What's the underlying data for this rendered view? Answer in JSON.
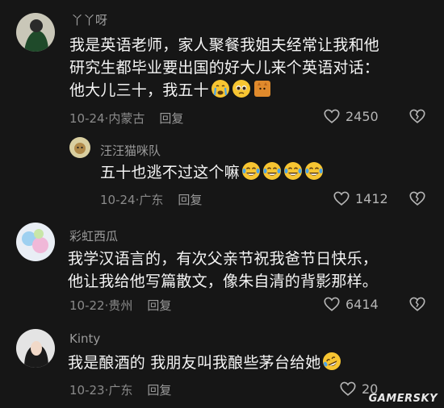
{
  "comments": [
    {
      "user": "丫丫呀",
      "lines": [
        "我是英语老师，家人聚餐我姐夫经常让我和他",
        "研究生都毕业要出国的好大儿来个英语对话：",
        "他大儿三十，我五十"
      ],
      "emojis": [
        "crying-face-emoji",
        "pleading-face-emoji",
        "cat-sticker-emoji"
      ],
      "date": "10-24",
      "location": "内蒙古",
      "reply_label": "回复",
      "likes": "2450"
    },
    {
      "user": "汪汪猫咪队",
      "lines": [
        "五十也逃不过这个嘛"
      ],
      "emojis": [
        "tears-of-joy-emoji",
        "tears-of-joy-emoji",
        "tears-of-joy-emoji",
        "tears-of-joy-emoji"
      ],
      "date": "10-24",
      "location": "广东",
      "reply_label": "回复",
      "likes": "1412"
    },
    {
      "user": "彩虹西瓜",
      "lines": [
        "我学汉语言的，有次父亲节祝我爸节日快乐，",
        "他让我给他写篇散文，像朱自清的背影那样。"
      ],
      "emojis": [],
      "date": "10-22",
      "location": "贵州",
      "reply_label": "回复",
      "likes": "6414"
    },
    {
      "user": "Kinty",
      "lines": [
        "我是酿酒的 我朋友叫我酿些茅台给她"
      ],
      "emojis": [
        "rolling-laughing-emoji"
      ],
      "date": "10-23",
      "location": "广东",
      "reply_label": "回复",
      "likes": "20"
    }
  ],
  "watermark": "GAMERSKY",
  "colors": {
    "background": "#161616",
    "text": "#f4f4f4",
    "muted": "#8a8a8a",
    "emoji_yellow": "#f7c532"
  }
}
